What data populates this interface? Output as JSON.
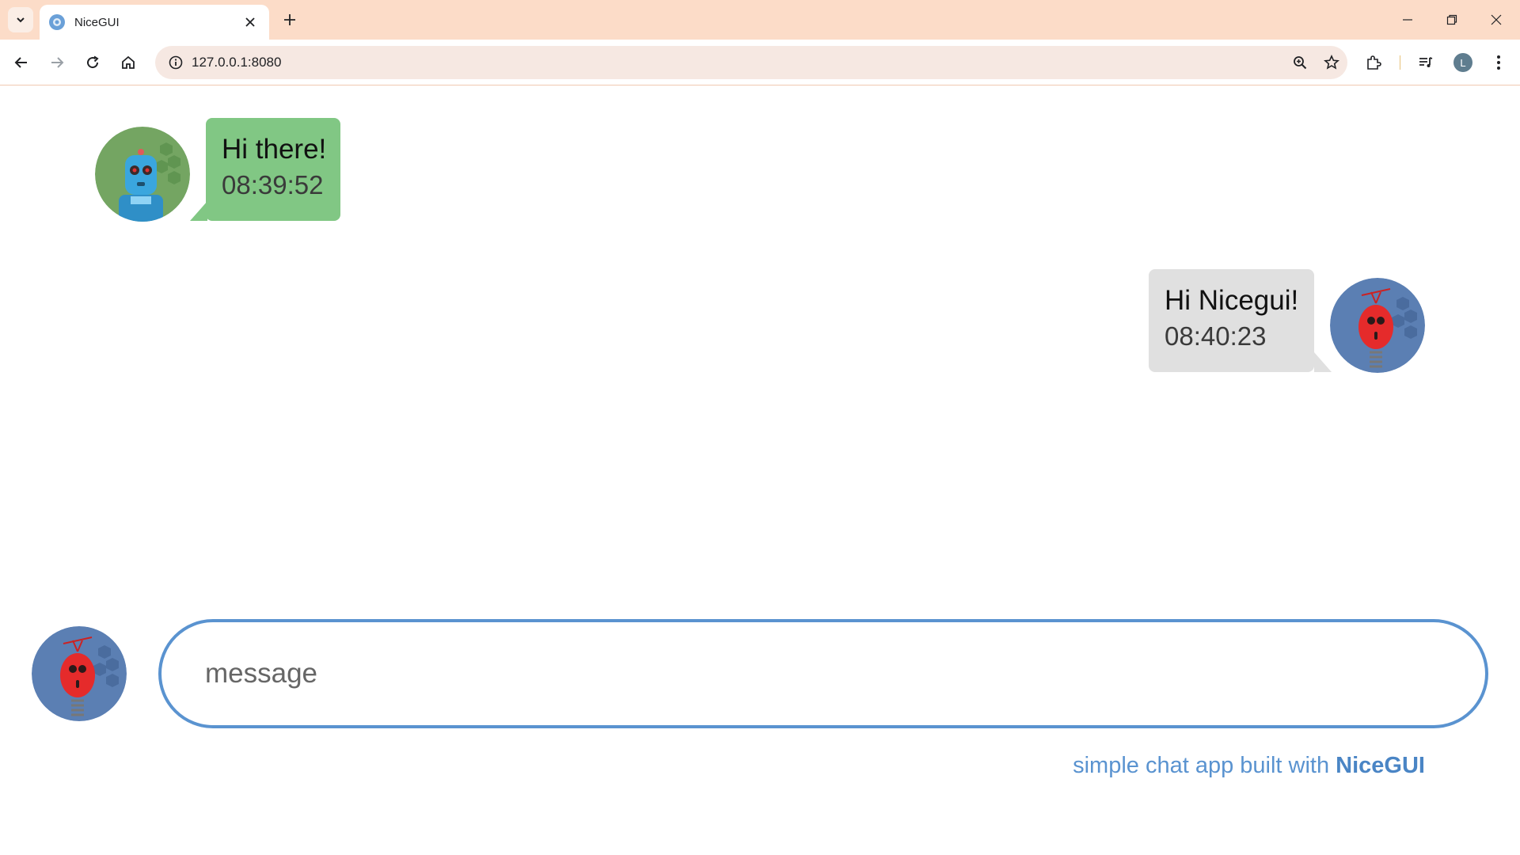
{
  "browser": {
    "tab_title": "NiceGUI",
    "url": "127.0.0.1:8080",
    "profile_initial": "L"
  },
  "chat": {
    "messages": [
      {
        "text": "Hi there!",
        "time": "08:39:52",
        "side": "received",
        "bubble_color": "#81c784"
      },
      {
        "text": "Hi Nicegui!",
        "time": "08:40:23",
        "side": "sent",
        "bubble_color": "#e0e0e0"
      }
    ],
    "input_placeholder": "message",
    "footer_text": "simple chat app built with",
    "footer_link": "NiceGUI"
  },
  "colors": {
    "accent": "#5a93d0",
    "tabbar": "#fcdcc8"
  },
  "icons": [
    "tab-list-icon",
    "nicegui-favicon-icon",
    "close-icon",
    "plus-icon",
    "minimize-icon",
    "restore-icon",
    "close-window-icon",
    "back-icon",
    "forward-icon",
    "reload-icon",
    "home-icon",
    "site-info-icon",
    "zoom-icon",
    "bookmark-star-icon",
    "extensions-icon",
    "media-controls-icon",
    "menu-icon"
  ]
}
